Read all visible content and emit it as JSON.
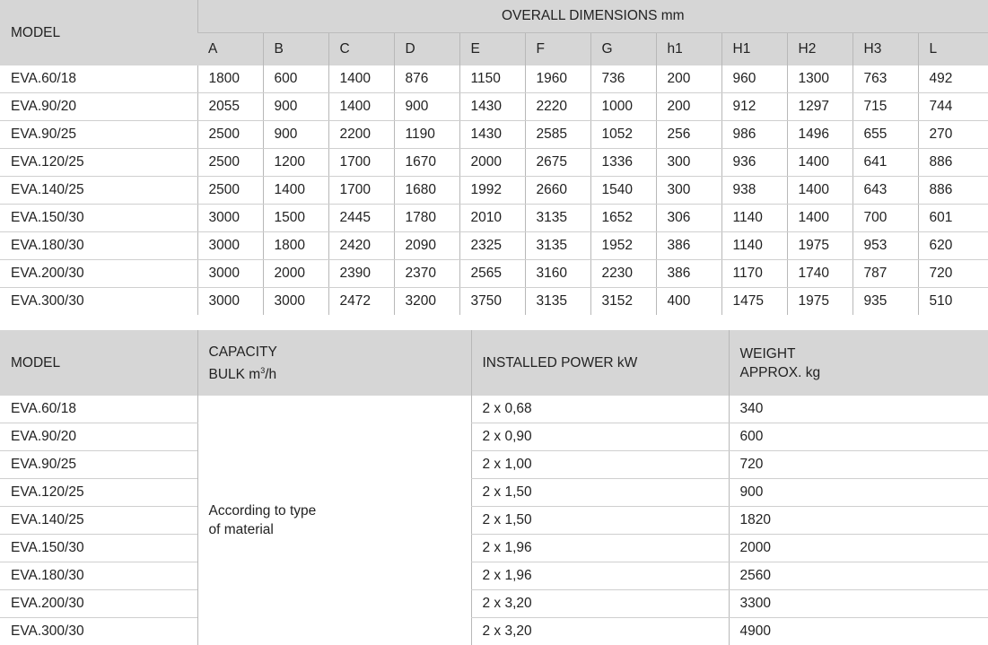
{
  "dims_table": {
    "model_header": "MODEL",
    "group_header": "OVERALL DIMENSIONS mm",
    "columns": [
      "A",
      "B",
      "C",
      "D",
      "E",
      "F",
      "G",
      "h1",
      "H1",
      "H2",
      "H3",
      "L"
    ],
    "rows": [
      {
        "model": "EVA.60/18",
        "values": [
          "1800",
          "600",
          "1400",
          "876",
          "1150",
          "1960",
          "736",
          "200",
          "960",
          "1300",
          "763",
          "492"
        ]
      },
      {
        "model": "EVA.90/20",
        "values": [
          "2055",
          "900",
          "1400",
          "900",
          "1430",
          "2220",
          "1000",
          "200",
          "912",
          "1297",
          "715",
          "744"
        ]
      },
      {
        "model": "EVA.90/25",
        "values": [
          "2500",
          "900",
          "2200",
          "1190",
          "1430",
          "2585",
          "1052",
          "256",
          "986",
          "1496",
          "655",
          "270"
        ]
      },
      {
        "model": "EVA.120/25",
        "values": [
          "2500",
          "1200",
          "1700",
          "1670",
          "2000",
          "2675",
          "1336",
          "300",
          "936",
          "1400",
          "641",
          "886"
        ]
      },
      {
        "model": "EVA.140/25",
        "values": [
          "2500",
          "1400",
          "1700",
          "1680",
          "1992",
          "2660",
          "1540",
          "300",
          "938",
          "1400",
          "643",
          "886"
        ]
      },
      {
        "model": "EVA.150/30",
        "values": [
          "3000",
          "1500",
          "2445",
          "1780",
          "2010",
          "3135",
          "1652",
          "306",
          "1140",
          "1400",
          "700",
          "601"
        ]
      },
      {
        "model": "EVA.180/30",
        "values": [
          "3000",
          "1800",
          "2420",
          "2090",
          "2325",
          "3135",
          "1952",
          "386",
          "1140",
          "1975",
          "953",
          "620"
        ]
      },
      {
        "model": "EVA.200/30",
        "values": [
          "3000",
          "2000",
          "2390",
          "2370",
          "2565",
          "3160",
          "2230",
          "386",
          "1170",
          "1740",
          "787",
          "720"
        ]
      },
      {
        "model": "EVA.300/30",
        "values": [
          "3000",
          "3000",
          "2472",
          "3200",
          "3750",
          "3135",
          "3152",
          "400",
          "1475",
          "1975",
          "935",
          "510"
        ]
      }
    ]
  },
  "specs_table": {
    "model_header": "MODEL",
    "capacity_header_line1": "CAPACITY",
    "capacity_header_line2": "BULK m",
    "capacity_header_sup": "3",
    "capacity_header_suffix": "/h",
    "power_header": "INSTALLED POWER kW",
    "weight_header_line1": "WEIGHT",
    "weight_header_line2": "APPROX. kg",
    "capacity_value_line1": "According to type",
    "capacity_value_line2": "of material",
    "rows": [
      {
        "model": "EVA.60/18",
        "power": "2 x 0,68",
        "weight": "340"
      },
      {
        "model": "EVA.90/20",
        "power": "2 x 0,90",
        "weight": "600"
      },
      {
        "model": "EVA.90/25",
        "power": "2 x 1,00",
        "weight": "720"
      },
      {
        "model": "EVA.120/25",
        "power": "2 x 1,50",
        "weight": "900"
      },
      {
        "model": "EVA.140/25",
        "power": "2 x 1,50",
        "weight": "1820"
      },
      {
        "model": "EVA.150/30",
        "power": "2 x 1,96",
        "weight": "2000"
      },
      {
        "model": "EVA.180/30",
        "power": "2 x 1,96",
        "weight": "2560"
      },
      {
        "model": "EVA.200/30",
        "power": "2 x 3,20",
        "weight": "3300"
      },
      {
        "model": "EVA.300/30",
        "power": "2 x 3,20",
        "weight": "4900"
      }
    ]
  }
}
